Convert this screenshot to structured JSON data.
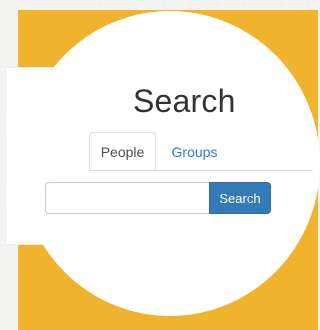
{
  "page": {
    "title": "Search"
  },
  "tabs": [
    {
      "label": "People",
      "active": true
    },
    {
      "label": "Groups",
      "active": false
    }
  ],
  "search": {
    "input_value": "",
    "placeholder": "",
    "button_label": "Search"
  },
  "colors": {
    "accent": "#337ab7",
    "frame": "#efb32d",
    "background": "#f3f3f2"
  }
}
